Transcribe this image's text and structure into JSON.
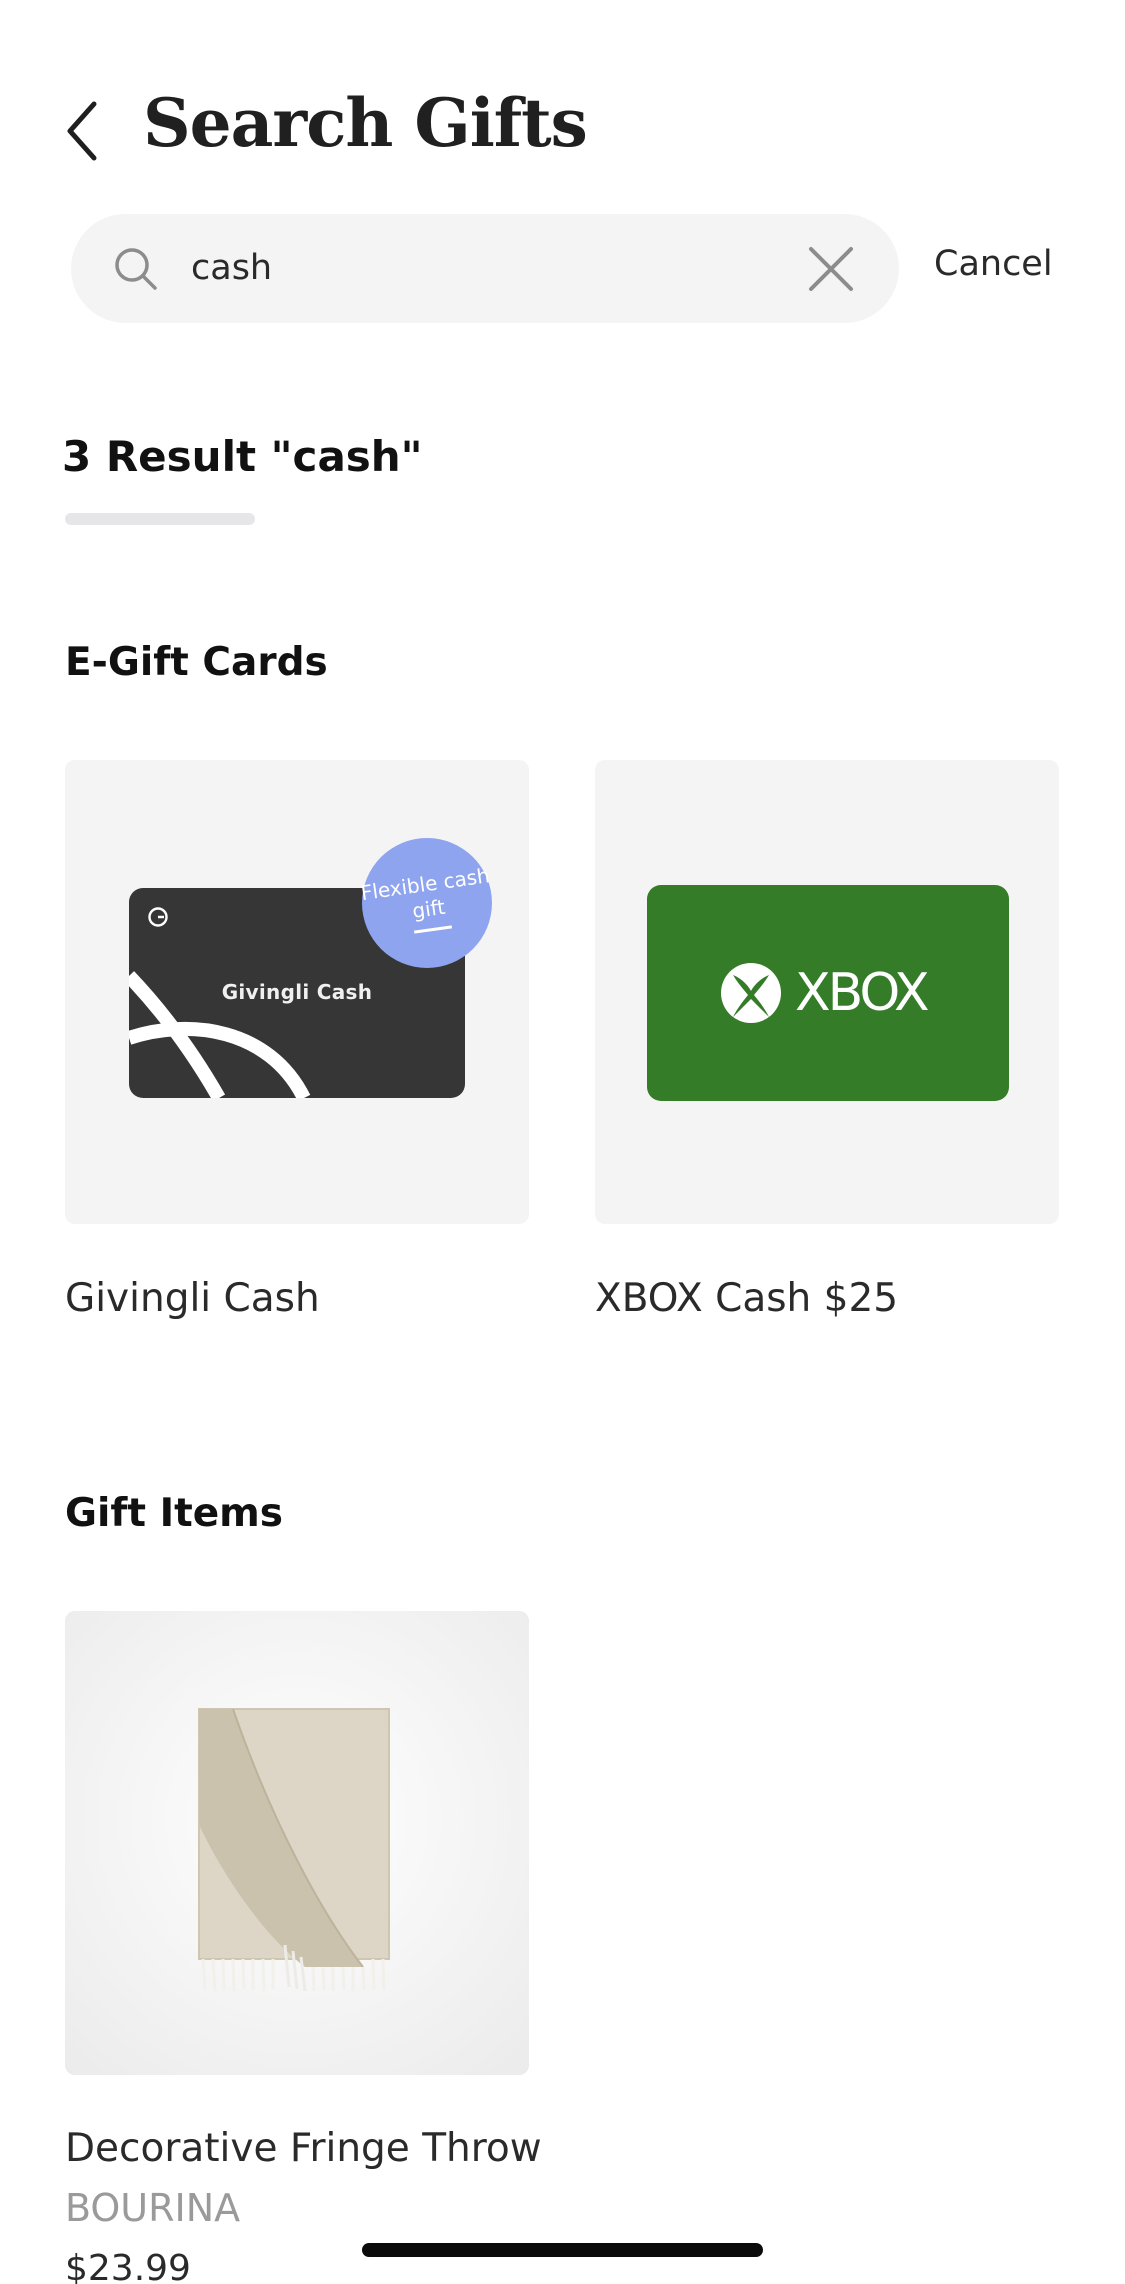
{
  "header": {
    "title": "Search Gifts"
  },
  "search": {
    "value": "cash",
    "placeholder": "",
    "cancel_label": "Cancel"
  },
  "results": {
    "tab_label": "3 Result \"cash\""
  },
  "egift_section": {
    "title": "E-Gift Cards",
    "items": [
      {
        "name": "Givingli Cash",
        "card_label": "Givingli Cash",
        "badge_text": "Flexible cash gift",
        "card_color": "#363637",
        "badge_color": "#8fa4ef"
      },
      {
        "name": "XBOX Cash $25",
        "card_label": "XBOX",
        "card_color": "#357c28"
      }
    ]
  },
  "gift_items_section": {
    "title": "Gift Items",
    "items": [
      {
        "name": "Decorative Fringe Throw",
        "brand": "BOURINA",
        "price": "$23.99"
      }
    ]
  },
  "colors": {
    "search_bg": "#f4f4f5",
    "tile_bg": "#f4f4f5",
    "underline": "#e6e6e8"
  },
  "icons": {
    "back": "chevron-left-icon",
    "search": "search-icon",
    "clear": "close-icon"
  }
}
